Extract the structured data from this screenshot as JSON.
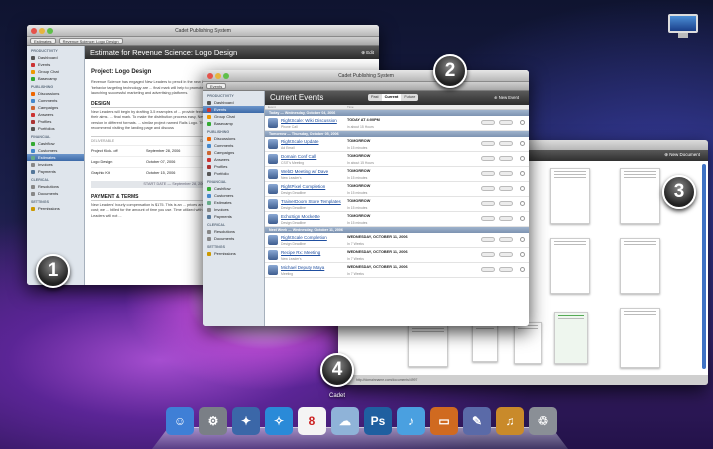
{
  "desktop": {
    "monitor_icon": "imac-icon"
  },
  "badges": [
    "1",
    "2",
    "3",
    "4"
  ],
  "win1": {
    "title": "Cadet Publishing System",
    "toolbar": [
      "Estimates",
      "Revenue Science: Logo Design"
    ],
    "header": "Estimate for Revenue Science: Logo Design",
    "edit": "Edit",
    "project": "Project: Logo Design",
    "intro": "Revenue Science has engaged New Leaders to pencil in the new logo. The Revenue Science 'behavior targeting technology are ... final mark will help to promote Revenue Science' brand as ... launching successful marketing and advertising platforms.",
    "design_h": "DESIGN",
    "design_p": "New Leaders will begin by drafting 3-5 examples of ... provide feedback on which design best meets their aims. ... final mark. To make the distribution process easy, New ... property as well as multiple version in different formats. ... similar project named Rails Logo. The goal was to develop ... few. We recommend visiting the landing page and discuss",
    "table_h": [
      "DELIVERABLE",
      "DATE"
    ],
    "rows": [
      [
        "Project Kick- off",
        "September 28, 2006"
      ],
      [
        "Logo Design",
        "October 07, 2006"
      ],
      [
        "Graphic Kit",
        "October 15, 2006"
      ]
    ],
    "start": "START DATE — September 28, 2006",
    "pay_h": "PAYMENT & TERMS",
    "pay_p": "New Leaders' hourly compensation is $175. This is an ... prices are within a 15% range of their final cost; we ... billed for the amount of time you use. Time utilized with ... of 15 of October. New Leaders will not ...",
    "sidebar": [
      {
        "h": "Productivity",
        "items": [
          [
            "Dashboard",
            "#555"
          ],
          [
            "Events",
            "#c33"
          ],
          [
            "Group Chat",
            "#e90"
          ],
          [
            "Basecamp",
            "#3a3"
          ]
        ]
      },
      {
        "h": "Publishing",
        "items": [
          [
            "Discussions",
            "#e60"
          ],
          [
            "Comments",
            "#48c"
          ],
          [
            "Campaigns",
            "#c63"
          ],
          [
            "Answers",
            "#c33"
          ],
          [
            "Profiles",
            "#a33"
          ],
          [
            "Portfolios",
            "#555"
          ]
        ]
      },
      {
        "h": "Financial",
        "items": [
          [
            "Cashflow",
            "#3a3"
          ],
          [
            "Customers",
            "#48c"
          ],
          [
            "Estimates",
            "#6a8"
          ],
          [
            "Invoices",
            "#888"
          ],
          [
            "Payments",
            "#579"
          ]
        ]
      },
      {
        "h": "Clerical",
        "items": [
          [
            "Resolutions",
            "#888"
          ],
          [
            "Documents",
            "#888"
          ]
        ]
      },
      {
        "h": "Settings",
        "items": [
          [
            "Permissions",
            "#c90"
          ]
        ]
      }
    ],
    "selected": "Estimates"
  },
  "win2": {
    "title": "Cadet Publishing System",
    "toolbar": "Events",
    "header": "Current Events",
    "seg": [
      "Past",
      "Current",
      "Future"
    ],
    "new": "New Event",
    "cols": [
      "Event",
      "Time"
    ],
    "day1": "Today — Wednesday, October 04, 2006",
    "first": {
      "t": "RightScale: Wiki Discussion",
      "s": "Phone Call",
      "w": "TODAY AT 4:00PM",
      "w2": "in about 15 Hours"
    },
    "day2": "Tomorrow — Thursday, October 05, 2006",
    "events": [
      {
        "t": "RightScale Update",
        "s": "Ad Email",
        "w": "TOMORROW",
        "w2": "In 15 minutes"
      },
      {
        "t": "Domain Conf Call",
        "s": "CSIT's Meeting",
        "w": "TOMORROW",
        "w2": "In about 15 Hours"
      },
      {
        "t": "WebD Meeting w/ Dave",
        "s": "New Leader's",
        "w": "TOMORROW",
        "w2": "In 15 minutes"
      },
      {
        "t": "RightPixel Completion",
        "s": "Design Deadline",
        "w": "TOMORROW",
        "w2": "In 15 minutes"
      },
      {
        "t": "TrainerDoom Store Templates",
        "s": "Design Deadline",
        "w": "TOMORROW",
        "w2": "In 15 minutes"
      },
      {
        "t": "EchoSign Mockette",
        "s": "Design Deadline",
        "w": "TOMORROW",
        "w2": "In 15 minutes"
      }
    ],
    "day3": "Next Week — Wednesday, October 11, 2006",
    "later": [
      {
        "t": "RightScale Completion",
        "s": "Design Deadline",
        "w": "WEDNESDAY, OCTOBER 11, 2006",
        "w2": "In 7 Weeks"
      },
      {
        "t": "Recipe Rx: Meeting",
        "s": "New Leader's",
        "w": "WEDNESDAY, OCTOBER 11, 2006",
        "w2": "In 7 Weeks"
      },
      {
        "t": "Michael Deputy Maya",
        "s": "Meeting",
        "w": "WEDNESDAY, OCTOBER 11, 2006",
        "w2": "In 7 Weeks"
      }
    ],
    "sidebar": [
      {
        "h": "Productivity",
        "items": [
          [
            "Dashboard",
            "#555"
          ],
          [
            "Events",
            "#c33"
          ],
          [
            "Group Chat",
            "#e90"
          ],
          [
            "Basecamp",
            "#3a3"
          ]
        ]
      },
      {
        "h": "Publishing",
        "items": [
          [
            "Discussions",
            "#e60"
          ],
          [
            "Comments",
            "#48c"
          ],
          [
            "Campaigns",
            "#c63"
          ],
          [
            "Answers",
            "#c33"
          ],
          [
            "Profiles",
            "#a33"
          ],
          [
            "Portfolio",
            "#555"
          ]
        ]
      },
      {
        "h": "Financial",
        "items": [
          [
            "Cashflow",
            "#3a3"
          ],
          [
            "Customers",
            "#48c"
          ],
          [
            "Estimates",
            "#6a8"
          ],
          [
            "Invoices",
            "#888"
          ],
          [
            "Payments",
            "#579"
          ]
        ]
      },
      {
        "h": "Clerical",
        "items": [
          [
            "Resolutions",
            "#888"
          ],
          [
            "Documents",
            "#888"
          ]
        ]
      },
      {
        "h": "Settings",
        "items": [
          [
            "Permissions",
            "#c90"
          ]
        ]
      }
    ],
    "selected": "Events"
  },
  "win3": {
    "new_doc": "New Document",
    "url": "http://domainname.com/documents/4997"
  },
  "dock": {
    "label": "Cadet",
    "icons": [
      {
        "name": "finder-icon",
        "g": "☺",
        "c": "#3f7fd6"
      },
      {
        "name": "system-prefs-icon",
        "g": "⚙",
        "c": "#7a7f86"
      },
      {
        "name": "preview-icon",
        "g": "✦",
        "c": "#3b67a8"
      },
      {
        "name": "safari-icon",
        "g": "✧",
        "c": "#2a8ad8"
      },
      {
        "name": "ical-icon",
        "g": "8",
        "c": "#f4f4f4"
      },
      {
        "name": "cadet-icon",
        "g": "☁",
        "c": "#8fb3d8"
      },
      {
        "name": "photoshop-icon",
        "g": "Ps",
        "c": "#1f5fa0"
      },
      {
        "name": "itunes-icon",
        "g": "♪",
        "c": "#4aa0e0"
      },
      {
        "name": "keynote-icon",
        "g": "▭",
        "c": "#d06a20"
      },
      {
        "name": "xcode-icon",
        "g": "✎",
        "c": "#5a6aa8"
      },
      {
        "name": "garageband-icon",
        "g": "♫",
        "c": "#c98a2a"
      },
      {
        "name": "trash-icon",
        "g": "♲",
        "c": "#8a8f96"
      }
    ]
  }
}
